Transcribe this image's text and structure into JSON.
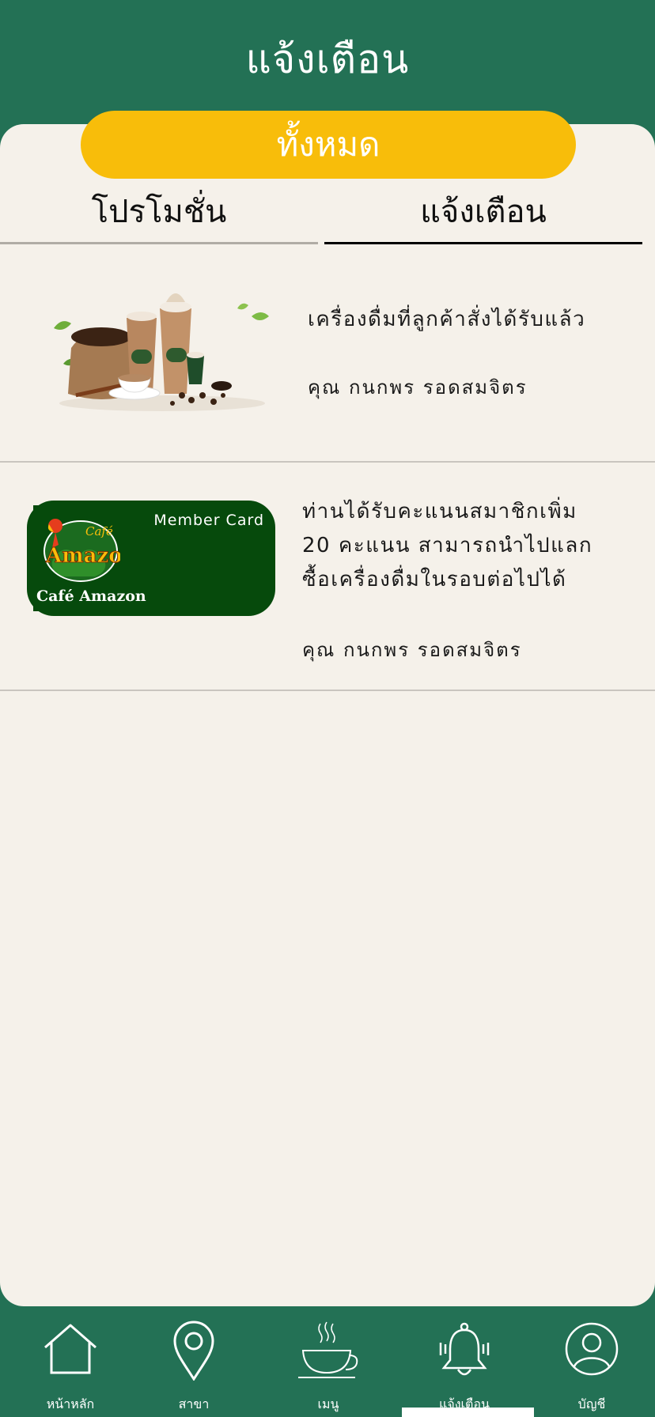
{
  "header": {
    "title": "แจ้งเตือน"
  },
  "filter": {
    "label": "ทั้งหมด"
  },
  "tabs": [
    {
      "label": "โปรโมชั่น",
      "active": false
    },
    {
      "label": "แจ้งเตือน",
      "active": true
    }
  ],
  "notifications": [
    {
      "message": "เครื่องดื่มที่ลูกค้าสั่งได้รับแล้ว",
      "recipient": "คุณ กนกพร รอดสมจิตร",
      "image": "drinks-illustration"
    },
    {
      "message_lines": [
        "ท่านได้รับคะแนนสมาชิกเพิ่ม",
        "20 คะแนน สามารถนำไปแลก",
        "ซื้อเครื่องดื่มในรอบต่อไปได้"
      ],
      "recipient": "คุณ กนกพร รอดสมจิตร",
      "card": {
        "label": "Member Card",
        "brand": "Café Amazon",
        "logo_top": "Café",
        "logo_main": "AmazoN"
      }
    }
  ],
  "nav": [
    {
      "label": "หน้าหลัก",
      "icon": "home-icon"
    },
    {
      "label": "สาขา",
      "icon": "location-pin-icon"
    },
    {
      "label": "เมนู",
      "icon": "coffee-cup-icon"
    },
    {
      "label": "แจ้งเตือน",
      "icon": "bell-icon"
    },
    {
      "label": "บัญชี",
      "icon": "user-icon"
    }
  ],
  "colors": {
    "brand_green": "#237155",
    "accent_yellow": "#f8bd0a",
    "background": "#f5f1ea",
    "card_green": "#064a0c"
  }
}
